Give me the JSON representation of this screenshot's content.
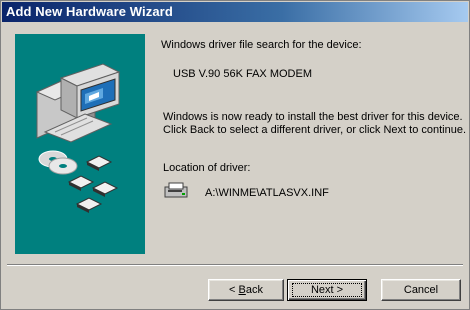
{
  "window": {
    "title": "Add New Hardware Wizard"
  },
  "content": {
    "search_heading": "Windows driver file search for the device:",
    "device_name": "USB V.90 56K FAX MODEM",
    "ready_line1": "Windows is now ready to install the best driver for this device.",
    "ready_line2": "Click Back to select a different driver, or click Next to continue.",
    "location_label": "Location of driver:",
    "driver_path": "A:\\WINME\\ATLASVX.INF"
  },
  "buttons": {
    "back_prefix": "< ",
    "back_mnemonic": "B",
    "back_rest": "ack",
    "next": "Next >",
    "cancel": "Cancel"
  },
  "colors": {
    "dialog_face": "#d4d0c8",
    "art_panel": "#00807f",
    "title_start": "#0a246a",
    "title_end": "#a6caf0"
  },
  "icons": [
    "computer-icon",
    "cd-disc-icon",
    "floppy-disk-icon",
    "floppy-drive-icon"
  ]
}
